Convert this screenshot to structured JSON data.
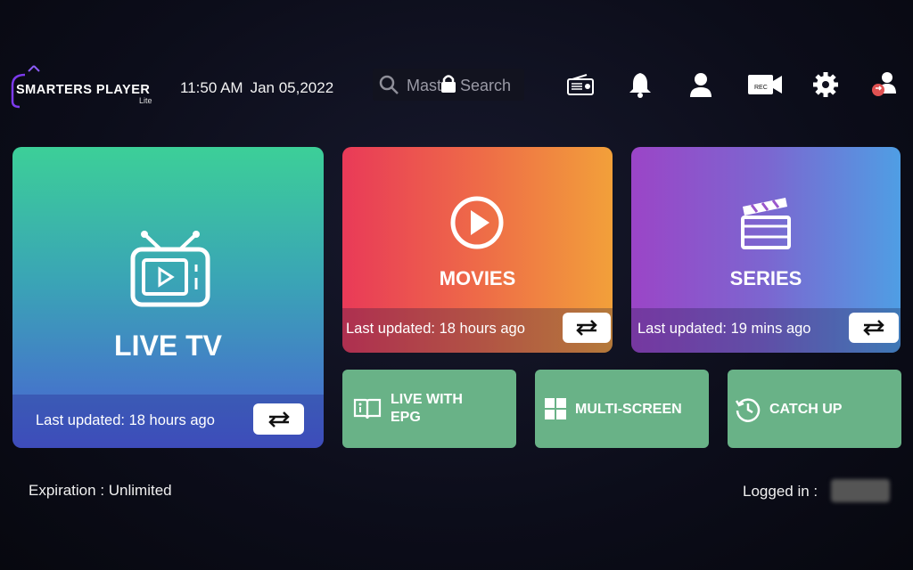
{
  "header": {
    "logo_text": "SMARTERS PLAYER",
    "logo_sub": "Lite",
    "time": "11:50 AM",
    "date": "Jan 05,2022",
    "search_placeholder": "Master Search",
    "icons": [
      "radio-icon",
      "bell-icon",
      "user-icon",
      "rec-icon",
      "gear-icon",
      "switch-user-icon"
    ]
  },
  "tiles": {
    "live_tv": {
      "title": "LIVE TV",
      "updated": "Last updated: 18 hours ago"
    },
    "movies": {
      "title": "MOVIES",
      "updated": "Last updated: 18 hours ago"
    },
    "series": {
      "title": "SERIES",
      "updated": "Last updated: 19 mins ago"
    },
    "epg": {
      "line1": "LIVE WITH",
      "line2": "EPG"
    },
    "multiscreen": {
      "label": "MULTI-SCREEN"
    },
    "catchup": {
      "label": "CATCH UP"
    }
  },
  "footer": {
    "expiration": "Expiration : Unlimited",
    "logged_in": "Logged in :"
  },
  "colors": {
    "live_gradient": [
      "#3ccf98",
      "#4a60d4"
    ],
    "movies_gradient": [
      "#e93a58",
      "#f2a03a"
    ],
    "series_gradient": [
      "#9b45c7",
      "#4f9ee4"
    ],
    "tile_green": "#69b287"
  }
}
